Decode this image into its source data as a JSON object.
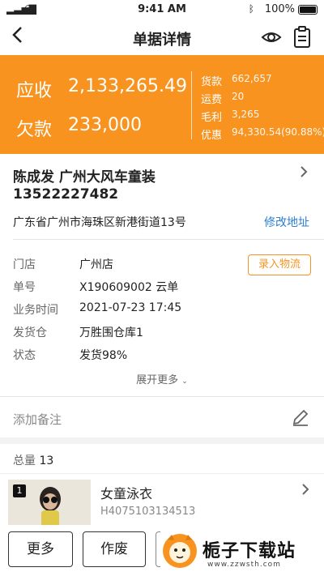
{
  "status_bar": {
    "time": "9:41 AM",
    "battery": "100%"
  },
  "nav": {
    "title": "单据详情"
  },
  "banner": {
    "receivable_label": "应收",
    "receivable_value": "2,133,265.49",
    "owed_label": "欠款",
    "owed_value": "233,000",
    "stats": [
      {
        "label": "货款",
        "value": "662,657"
      },
      {
        "label": "运费",
        "value": "20"
      },
      {
        "label": "毛利",
        "value": "3,265"
      },
      {
        "label": "优惠",
        "value": "94,330.54(90.88%)"
      }
    ],
    "background_color": "#f7931e"
  },
  "customer": {
    "name": "陈成发 广州大风车童装",
    "phone": "13522227482",
    "address": "广东省广州市海珠区新港街道13号",
    "edit_address_label": "修改地址"
  },
  "info": {
    "rows": [
      {
        "key": "门店",
        "value": "广州店"
      },
      {
        "key": "单号",
        "value": "X190609002 云单"
      },
      {
        "key": "业务时间",
        "value": "2021-07-23 17:45"
      },
      {
        "key": "发货仓",
        "value": "万胜围仓库1"
      },
      {
        "key": "状态",
        "value": "发货98%"
      }
    ],
    "logistics_button": "录入物流",
    "expand_label": "展开更多"
  },
  "remark": {
    "placeholder": "添加备注"
  },
  "items": {
    "total_label": "总量",
    "total_value": "13",
    "product": {
      "index": "1",
      "name": "女童泳衣",
      "code": "H4075103134513"
    }
  },
  "bottom_bar": {
    "more_label": "更多",
    "void_label": "作废"
  },
  "watermark": {
    "text": "栀子下载站",
    "url": "www.zzwsth.com"
  }
}
